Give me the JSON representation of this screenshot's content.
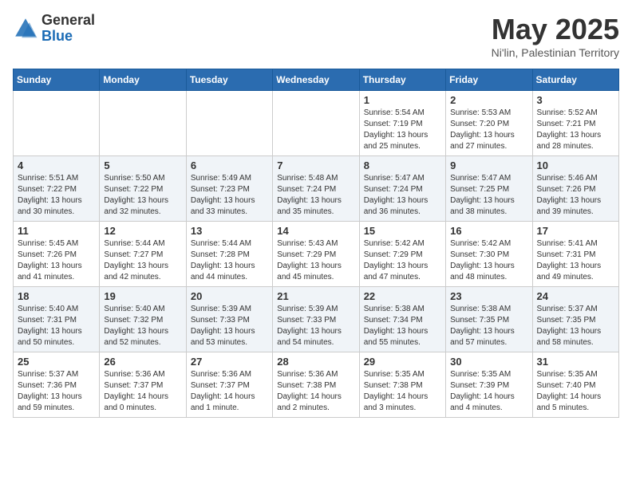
{
  "logo": {
    "general": "General",
    "blue": "Blue"
  },
  "header": {
    "month": "May 2025",
    "location": "Ni'lin, Palestinian Territory"
  },
  "days_of_week": [
    "Sunday",
    "Monday",
    "Tuesday",
    "Wednesday",
    "Thursday",
    "Friday",
    "Saturday"
  ],
  "weeks": [
    [
      {
        "day": "",
        "content": ""
      },
      {
        "day": "",
        "content": ""
      },
      {
        "day": "",
        "content": ""
      },
      {
        "day": "",
        "content": ""
      },
      {
        "day": "1",
        "content": "Sunrise: 5:54 AM\nSunset: 7:19 PM\nDaylight: 13 hours\nand 25 minutes."
      },
      {
        "day": "2",
        "content": "Sunrise: 5:53 AM\nSunset: 7:20 PM\nDaylight: 13 hours\nand 27 minutes."
      },
      {
        "day": "3",
        "content": "Sunrise: 5:52 AM\nSunset: 7:21 PM\nDaylight: 13 hours\nand 28 minutes."
      }
    ],
    [
      {
        "day": "4",
        "content": "Sunrise: 5:51 AM\nSunset: 7:22 PM\nDaylight: 13 hours\nand 30 minutes."
      },
      {
        "day": "5",
        "content": "Sunrise: 5:50 AM\nSunset: 7:22 PM\nDaylight: 13 hours\nand 32 minutes."
      },
      {
        "day": "6",
        "content": "Sunrise: 5:49 AM\nSunset: 7:23 PM\nDaylight: 13 hours\nand 33 minutes."
      },
      {
        "day": "7",
        "content": "Sunrise: 5:48 AM\nSunset: 7:24 PM\nDaylight: 13 hours\nand 35 minutes."
      },
      {
        "day": "8",
        "content": "Sunrise: 5:47 AM\nSunset: 7:24 PM\nDaylight: 13 hours\nand 36 minutes."
      },
      {
        "day": "9",
        "content": "Sunrise: 5:47 AM\nSunset: 7:25 PM\nDaylight: 13 hours\nand 38 minutes."
      },
      {
        "day": "10",
        "content": "Sunrise: 5:46 AM\nSunset: 7:26 PM\nDaylight: 13 hours\nand 39 minutes."
      }
    ],
    [
      {
        "day": "11",
        "content": "Sunrise: 5:45 AM\nSunset: 7:26 PM\nDaylight: 13 hours\nand 41 minutes."
      },
      {
        "day": "12",
        "content": "Sunrise: 5:44 AM\nSunset: 7:27 PM\nDaylight: 13 hours\nand 42 minutes."
      },
      {
        "day": "13",
        "content": "Sunrise: 5:44 AM\nSunset: 7:28 PM\nDaylight: 13 hours\nand 44 minutes."
      },
      {
        "day": "14",
        "content": "Sunrise: 5:43 AM\nSunset: 7:29 PM\nDaylight: 13 hours\nand 45 minutes."
      },
      {
        "day": "15",
        "content": "Sunrise: 5:42 AM\nSunset: 7:29 PM\nDaylight: 13 hours\nand 47 minutes."
      },
      {
        "day": "16",
        "content": "Sunrise: 5:42 AM\nSunset: 7:30 PM\nDaylight: 13 hours\nand 48 minutes."
      },
      {
        "day": "17",
        "content": "Sunrise: 5:41 AM\nSunset: 7:31 PM\nDaylight: 13 hours\nand 49 minutes."
      }
    ],
    [
      {
        "day": "18",
        "content": "Sunrise: 5:40 AM\nSunset: 7:31 PM\nDaylight: 13 hours\nand 50 minutes."
      },
      {
        "day": "19",
        "content": "Sunrise: 5:40 AM\nSunset: 7:32 PM\nDaylight: 13 hours\nand 52 minutes."
      },
      {
        "day": "20",
        "content": "Sunrise: 5:39 AM\nSunset: 7:33 PM\nDaylight: 13 hours\nand 53 minutes."
      },
      {
        "day": "21",
        "content": "Sunrise: 5:39 AM\nSunset: 7:33 PM\nDaylight: 13 hours\nand 54 minutes."
      },
      {
        "day": "22",
        "content": "Sunrise: 5:38 AM\nSunset: 7:34 PM\nDaylight: 13 hours\nand 55 minutes."
      },
      {
        "day": "23",
        "content": "Sunrise: 5:38 AM\nSunset: 7:35 PM\nDaylight: 13 hours\nand 57 minutes."
      },
      {
        "day": "24",
        "content": "Sunrise: 5:37 AM\nSunset: 7:35 PM\nDaylight: 13 hours\nand 58 minutes."
      }
    ],
    [
      {
        "day": "25",
        "content": "Sunrise: 5:37 AM\nSunset: 7:36 PM\nDaylight: 13 hours\nand 59 minutes."
      },
      {
        "day": "26",
        "content": "Sunrise: 5:36 AM\nSunset: 7:37 PM\nDaylight: 14 hours\nand 0 minutes."
      },
      {
        "day": "27",
        "content": "Sunrise: 5:36 AM\nSunset: 7:37 PM\nDaylight: 14 hours\nand 1 minute."
      },
      {
        "day": "28",
        "content": "Sunrise: 5:36 AM\nSunset: 7:38 PM\nDaylight: 14 hours\nand 2 minutes."
      },
      {
        "day": "29",
        "content": "Sunrise: 5:35 AM\nSunset: 7:38 PM\nDaylight: 14 hours\nand 3 minutes."
      },
      {
        "day": "30",
        "content": "Sunrise: 5:35 AM\nSunset: 7:39 PM\nDaylight: 14 hours\nand 4 minutes."
      },
      {
        "day": "31",
        "content": "Sunrise: 5:35 AM\nSunset: 7:40 PM\nDaylight: 14 hours\nand 5 minutes."
      }
    ]
  ]
}
